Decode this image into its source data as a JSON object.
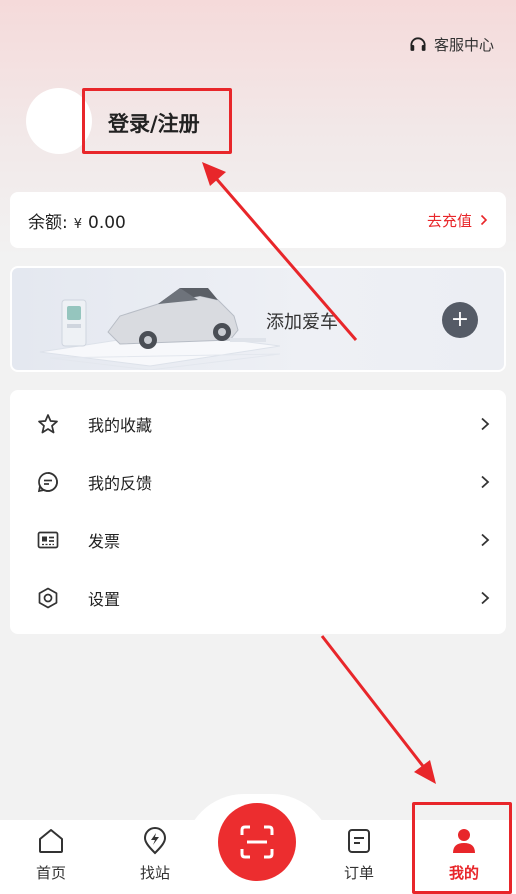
{
  "header": {
    "service_label": "客服中心",
    "login_label": "登录/注册"
  },
  "balance": {
    "label": "余额:",
    "currency": "¥",
    "amount": "0.00",
    "recharge_label": "去充值"
  },
  "car": {
    "add_label": "添加爱车",
    "add_button": "+"
  },
  "menu": {
    "items": [
      {
        "label": "我的收藏",
        "icon": "star-icon"
      },
      {
        "label": "我的反馈",
        "icon": "feedback-icon"
      },
      {
        "label": "发票",
        "icon": "invoice-icon"
      },
      {
        "label": "设置",
        "icon": "settings-icon"
      }
    ]
  },
  "tabbar": {
    "tabs": [
      {
        "label": "首页",
        "icon": "home-icon"
      },
      {
        "label": "找站",
        "icon": "station-icon"
      },
      {
        "label": "订单",
        "icon": "order-icon"
      },
      {
        "label": "我的",
        "icon": "profile-icon",
        "active": true
      }
    ],
    "scan_icon": "scan-icon"
  },
  "colors": {
    "accent": "#e8262a",
    "background": "#f2f2f2"
  }
}
